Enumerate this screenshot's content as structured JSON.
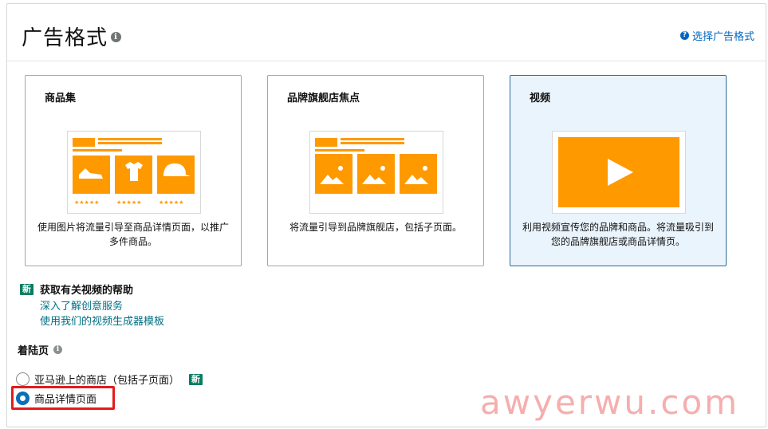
{
  "header": {
    "title": "广告格式",
    "help_link": "选择广告格式"
  },
  "cards": [
    {
      "title": "商品集",
      "description": "使用图片将流量引导至商品详情页面，以推广多件商品。",
      "selected": false
    },
    {
      "title": "品牌旗舰店焦点",
      "description": "将流量引导到品牌旗舰店，包括子页面。",
      "selected": false
    },
    {
      "title": "视频",
      "description": "利用视频宣传您的品牌和商品。将流量吸引到您的品牌旗舰店或商品详情页。",
      "selected": true
    }
  ],
  "badge_new": "新",
  "video_help": {
    "title": "获取有关视频的帮助",
    "links": [
      "深入了解创意服务",
      "使用我们的视频生成器模板"
    ]
  },
  "landing_page": {
    "label": "着陆页",
    "options": [
      {
        "label": "亚马逊上的商店（包括子页面）",
        "checked": false
      },
      {
        "label": "商品详情页面",
        "checked": true
      }
    ]
  },
  "watermark": "awyerwu.com",
  "colors": {
    "accent_orange": "#ff9900",
    "link_blue": "#0066c0",
    "link_teal": "#007185",
    "badge_green": "#067d62",
    "selected_border": "#2b6c96",
    "highlight_red": "#e31b1b"
  }
}
